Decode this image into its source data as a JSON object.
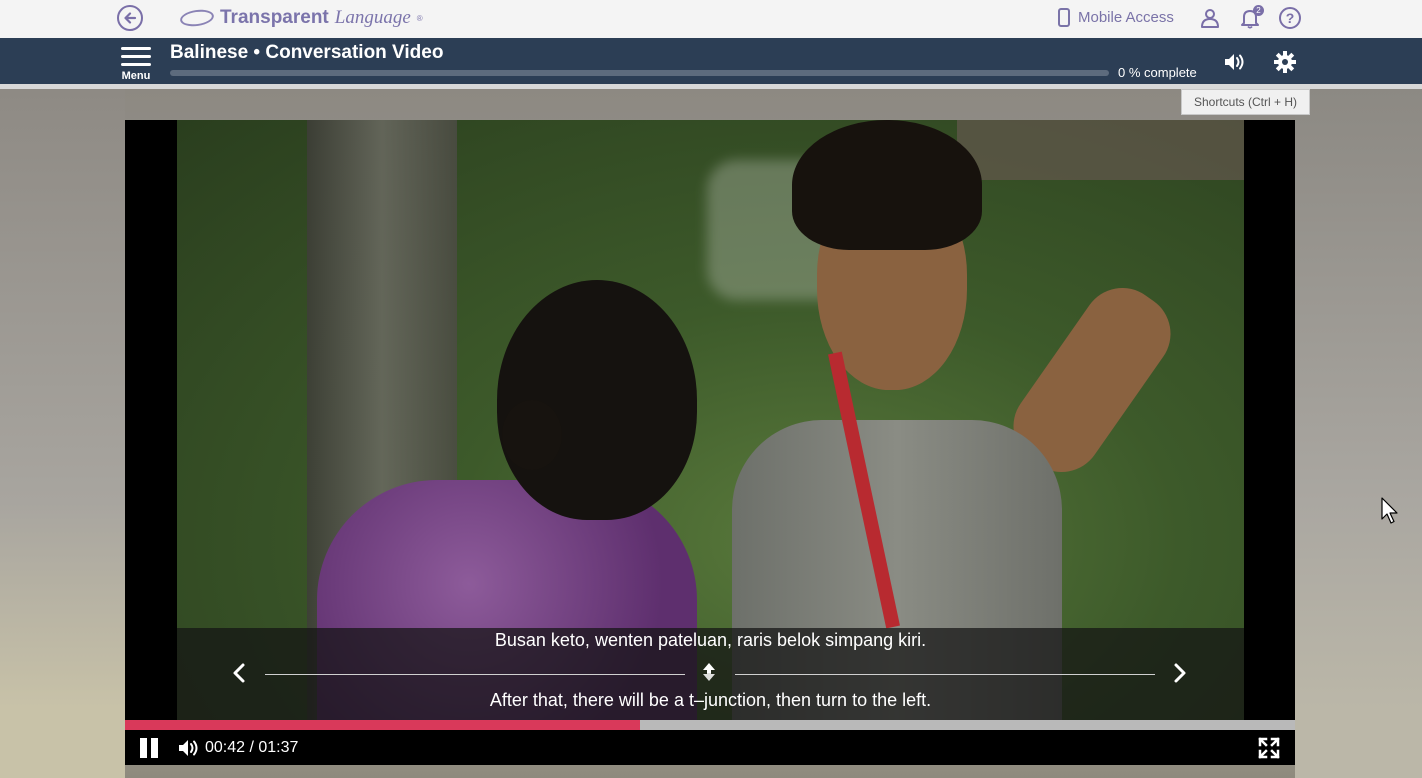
{
  "topbar": {
    "logo_bold": "Transparent",
    "logo_italic": "Language",
    "logo_mark": "®",
    "mobile_access_label": "Mobile Access",
    "notification_count": "2",
    "help_symbol": "?",
    "icons": [
      "back-arrow-icon",
      "phone-icon",
      "user-icon",
      "bell-icon",
      "help-icon"
    ]
  },
  "header": {
    "menu_label": "Menu",
    "title": "Balinese • Conversation Video",
    "progress_text": "0 % complete",
    "progress_fraction": 0.0,
    "icons": [
      "menu-icon",
      "speaker-icon",
      "gear-icon"
    ]
  },
  "tooltip": {
    "shortcuts": "Shortcuts (Ctrl + H)"
  },
  "player": {
    "subtitle_original": "Busan keto, wenten pateluan, raris belok simpang kiri.",
    "subtitle_translation": "After that, there will be a t–junction, then turn to the left.",
    "current_time": "00:42",
    "duration": "01:37",
    "time_display": "00:42 / 01:37",
    "played_fraction": 0.44,
    "state": "playing",
    "icons": [
      "pause-icon",
      "volume-icon",
      "fullscreen-icon",
      "prev-chevron-icon",
      "next-chevron-icon",
      "swap-icon"
    ]
  },
  "colors": {
    "header_bg": "#2c3e55",
    "brand_purple": "#7b74ab",
    "seek_played": "#d9395a",
    "seek_track": "#b9b9b9",
    "topbar_bg": "#f4f4f4"
  }
}
